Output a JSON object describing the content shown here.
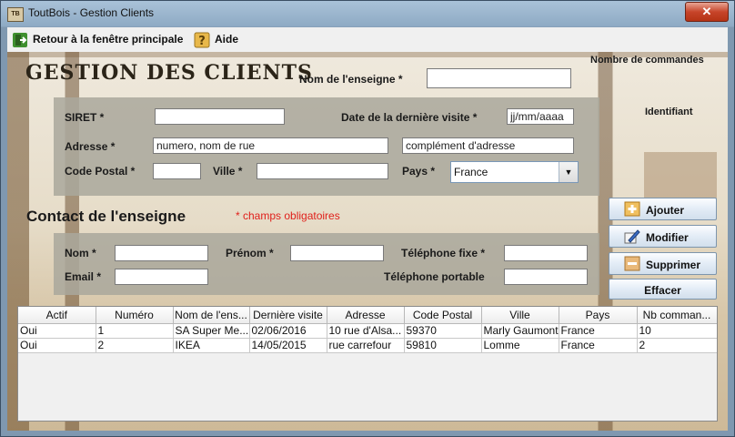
{
  "window": {
    "title": "ToutBois - Gestion Clients",
    "icon_text": "TB",
    "close_symbol": "✕"
  },
  "menu": {
    "back_label": "Retour à la fenêtre principale",
    "help_label": "Aide"
  },
  "heading": "GESTION DES CLIENTS",
  "top_fields": {
    "enseigne_label": "Nom de l'enseigne *",
    "enseigne_value": "",
    "commandes_label": "Nombre de commandes",
    "identifiant_label": "Identifiant"
  },
  "address_panel": {
    "siret_label": "SIRET *",
    "siret_value": "",
    "date_label": "Date de la dernière visite *",
    "date_placeholder": "jj/mm/aaaa",
    "adresse_label": "Adresse *",
    "adresse_placeholder": "numero, nom de rue",
    "complement_placeholder": "complément d'adresse",
    "cp_label": "Code Postal *",
    "ville_label": "Ville *",
    "pays_label": "Pays *",
    "pays_value": "France"
  },
  "contact": {
    "heading": "Contact de l'enseigne",
    "required_note": "* champs obligatoires",
    "nom_label": "Nom *",
    "prenom_label": "Prénom *",
    "tel_fixe_label": "Téléphone fixe *",
    "email_label": "Email *",
    "tel_portable_label": "Téléphone portable"
  },
  "buttons": {
    "ajouter": "Ajouter",
    "modifier": "Modifier",
    "supprimer": "Supprimer",
    "effacer": "Effacer"
  },
  "table": {
    "columns": [
      "Actif",
      "Numéro",
      "Nom de l'ens...",
      "Dernière visite",
      "Adresse",
      "Code Postal",
      "Ville",
      "Pays",
      "Nb comman..."
    ],
    "rows": [
      [
        "Oui",
        "1",
        "SA Super Me...",
        "02/06/2016",
        "10 rue d'Alsa...",
        "59370",
        "Marly Gaumont",
        "France",
        "10"
      ],
      [
        "Oui",
        "2",
        "IKEA",
        "14/05/2015",
        "rue carrefour",
        "59810",
        "Lomme",
        "France",
        "2"
      ]
    ]
  },
  "colors": {
    "required": "#e0201b",
    "panel": "#aaa89c",
    "title_bar": "#a9c2d8"
  },
  "icons": {
    "back": "exit-icon",
    "help": "help-icon",
    "add": "plus-icon",
    "edit": "pencil-icon",
    "delete": "minus-icon"
  }
}
